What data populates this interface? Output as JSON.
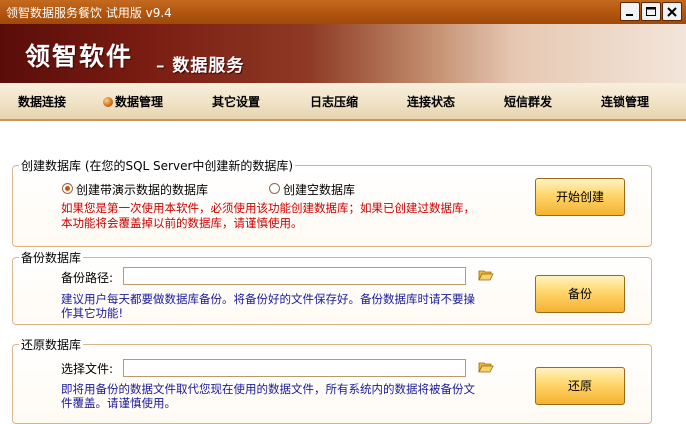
{
  "window": {
    "title": "领智数据服务餐饮 试用版 v9.4",
    "controls": [
      "minimize-icon",
      "maximize-icon",
      "close-icon"
    ]
  },
  "banner": {
    "brand": "领智软件",
    "subtitle": "– 数据服务"
  },
  "nav": {
    "items": [
      {
        "label": "数据连接"
      },
      {
        "label": "数据管理",
        "active": true
      },
      {
        "label": "其它设置"
      },
      {
        "label": "日志压缩"
      },
      {
        "label": "连接状态"
      },
      {
        "label": "短信群发"
      },
      {
        "label": "连锁管理"
      }
    ]
  },
  "create": {
    "title": "创建数据库 (在您的SQL Server中创建新的数据库)",
    "option_demo": "创建带演示数据的数据库",
    "option_empty": "创建空数据库",
    "selected": "option_demo",
    "warning_line1": "如果您是第一次使用本软件，必须使用该功能创建数据库；如果已创建过数据库，",
    "warning_line2": "本功能将会覆盖掉以前的数据库，请谨慎使用。",
    "button": "开始创建"
  },
  "backup": {
    "title": "备份数据库",
    "path_label": "备份路径:",
    "path_value": "",
    "note_line1": "建议用户每天都要做数据库备份。将备份好的文件保存好。备份数据库时请不要操",
    "note_line2": "作其它功能!",
    "button": "备份"
  },
  "restore": {
    "title": "还原数据库",
    "file_label": "选择文件:",
    "file_value": "",
    "note_line1": "即将用备份的数据文件取代您现在使用的数据文件，所有系统内的数据将被备份文",
    "note_line2": "件覆盖。请谨慎使用。",
    "button": "还原"
  },
  "colors": {
    "titlebar": "#b0530d",
    "banner_dark": "#5a0d0a",
    "warning_text": "#cc0000",
    "note_text": "#1a1a9a",
    "button_fill": "#ffd56a"
  }
}
